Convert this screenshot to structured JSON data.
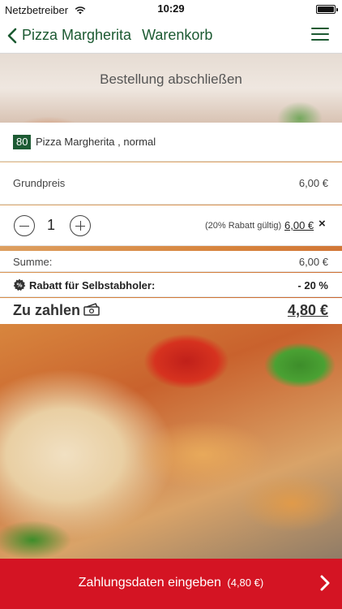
{
  "status_bar": {
    "carrier": "Netzbetreiber",
    "time": "10:29",
    "battery_level": 1.0
  },
  "nav": {
    "title": "Pizza Margherita",
    "subtitle": "Warenkorb",
    "back_icon": "chevron-left-icon",
    "menu_icon": "hamburger-menu-icon",
    "accent_color": "#1c5a32"
  },
  "banner": {
    "title": "Bestellung abschließen"
  },
  "cart_item": {
    "number": "80",
    "name": "Pizza Margherita , normal",
    "base_price_label": "Grundpreis",
    "base_price": "6,00 €",
    "quantity": "1",
    "discount_note": "(20% Rabatt gültig)",
    "line_total": "6,00 €",
    "remove_symbol": "×"
  },
  "summary": {
    "sum_label": "Summe:",
    "sum_value": "6,00 €",
    "discount_label": "Rabatt für Selbstabholer:",
    "discount_value": "- 20 %",
    "discount_icon": "discount-badge-icon",
    "total_label": "Zu zahlen",
    "total_icon": "cash-icon",
    "total_value": "4,80 €"
  },
  "cta": {
    "label": "Zahlungsdaten eingeben",
    "amount": "(4,80 €)",
    "arrow_icon": "chevron-right-icon",
    "color": "#d41423"
  }
}
